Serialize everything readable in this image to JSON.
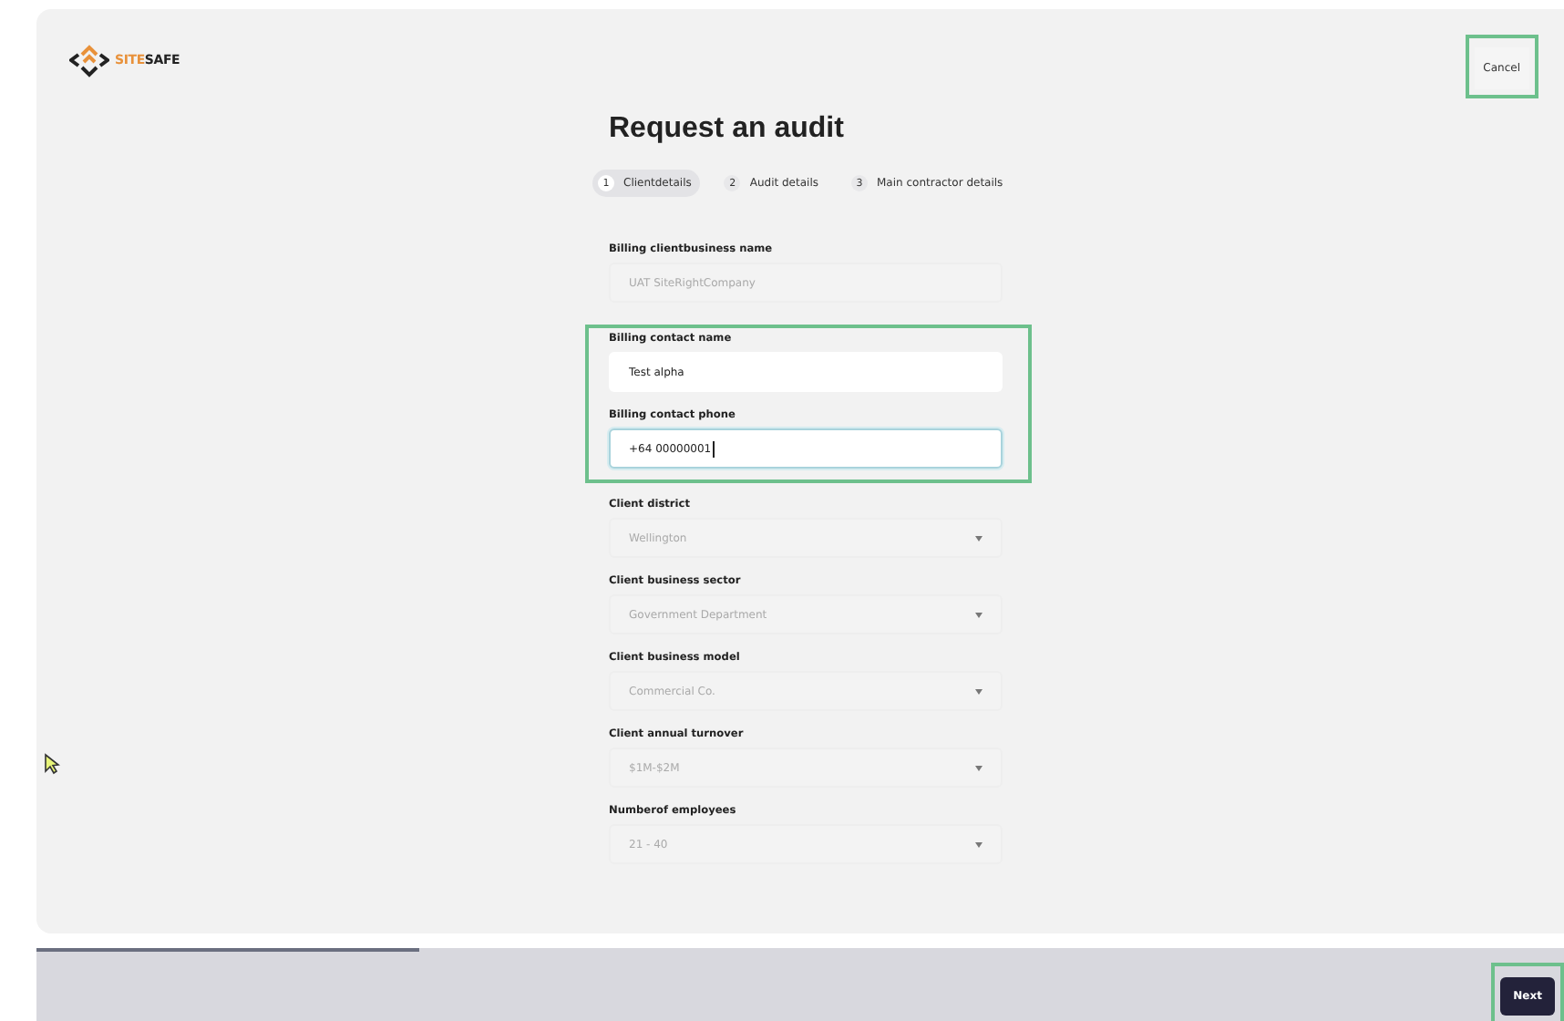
{
  "logo": {
    "part_1": "SITE",
    "part_2": "SAFE"
  },
  "cancel": {
    "label": "Cancel",
    "highlighted": true
  },
  "title": "Request an audit",
  "steps": [
    {
      "number": "1",
      "label": "Clientdetails",
      "selected": true
    },
    {
      "number": "2",
      "label": "Audit details",
      "selected": false
    },
    {
      "number": "3",
      "label": "Main contractor details",
      "selected": false
    }
  ],
  "field_groups": [
    {
      "highlighted": false,
      "fields": [
        {
          "kind": "text",
          "label": "Billing clientbusiness name",
          "value": "UAT SiteRightCompany",
          "disabled": true,
          "focused": false
        }
      ]
    },
    {
      "highlighted": true,
      "fields": [
        {
          "kind": "text",
          "label": "Billing contact name",
          "value": "Test alpha",
          "disabled": false,
          "focused": false
        },
        {
          "kind": "text",
          "label": "Billing contact phone",
          "value": "+64 00000001",
          "disabled": false,
          "focused": true
        }
      ]
    },
    {
      "highlighted": false,
      "fields": [
        {
          "kind": "select",
          "label": "Client district",
          "value": "Wellington",
          "disabled": true,
          "focused": false
        },
        {
          "kind": "select",
          "label": "Client business sector",
          "value": "Government Department",
          "disabled": true,
          "focused": false
        },
        {
          "kind": "select",
          "label": "Client business model",
          "value": "Commercial Co.",
          "disabled": true,
          "focused": false
        },
        {
          "kind": "select",
          "label": "Client annual turnover",
          "value": "$1M-$2M",
          "disabled": true,
          "focused": false
        },
        {
          "kind": "select",
          "label": "Numberof employees",
          "value": "21 - 40",
          "disabled": true,
          "focused": false
        }
      ]
    }
  ],
  "progress": {
    "level": 0.25
  },
  "next": {
    "label": "Next",
    "highlighted": true
  }
}
